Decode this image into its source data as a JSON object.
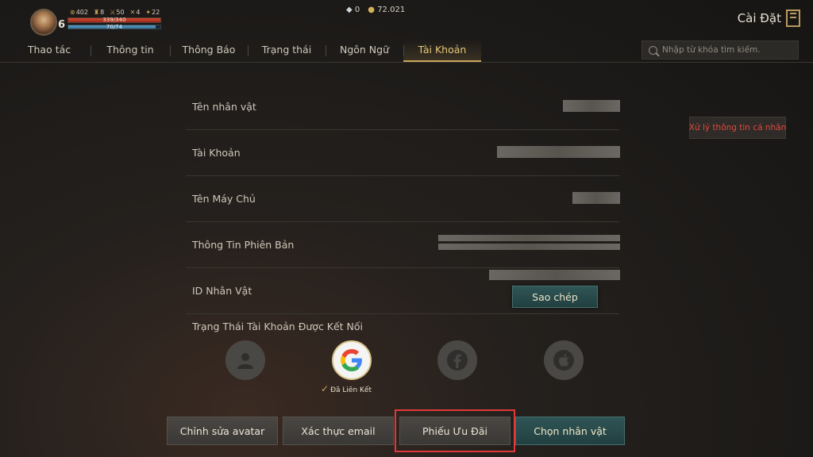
{
  "player": {
    "level": "6",
    "stats": [
      "402",
      "8",
      "50",
      "4",
      "22"
    ],
    "hp": {
      "text": "339/340",
      "fraction": 0.997
    },
    "mp": {
      "text": "70/74",
      "fraction": 0.946
    }
  },
  "currency": {
    "gems": "0",
    "gold": "72.021"
  },
  "header": {
    "title": "Cài Đặt"
  },
  "tabs": [
    {
      "label": "Thao tác"
    },
    {
      "label": "Thông tin"
    },
    {
      "label": "Thông Báo"
    },
    {
      "label": "Trạng thái"
    },
    {
      "label": "Ngôn Ngữ"
    },
    {
      "label": "Tài Khoản",
      "active": true
    }
  ],
  "search": {
    "placeholder": "Nhập từ khóa tìm kiếm."
  },
  "privacy_button": {
    "label": "Xử lý thông tin cá nhân"
  },
  "account": {
    "rows": [
      {
        "label": "Tên nhân vật"
      },
      {
        "label": "Tài Khoản"
      },
      {
        "label": "Tên Máy Chủ"
      },
      {
        "label": "Thông Tin Phiên Bản"
      },
      {
        "label": "ID Nhân Vật"
      }
    ],
    "copy_button": "Sao chép",
    "linked_title": "Trạng Thái Tài Khoản Được Kết Nối",
    "linked_status": "Đã Liên Kết"
  },
  "bottom_buttons": {
    "edit_avatar": "Chỉnh sửa avatar",
    "verify_email": "Xác thực email",
    "coupon": "Phiếu Ưu Đãi",
    "select_character": "Chọn nhân vật"
  }
}
